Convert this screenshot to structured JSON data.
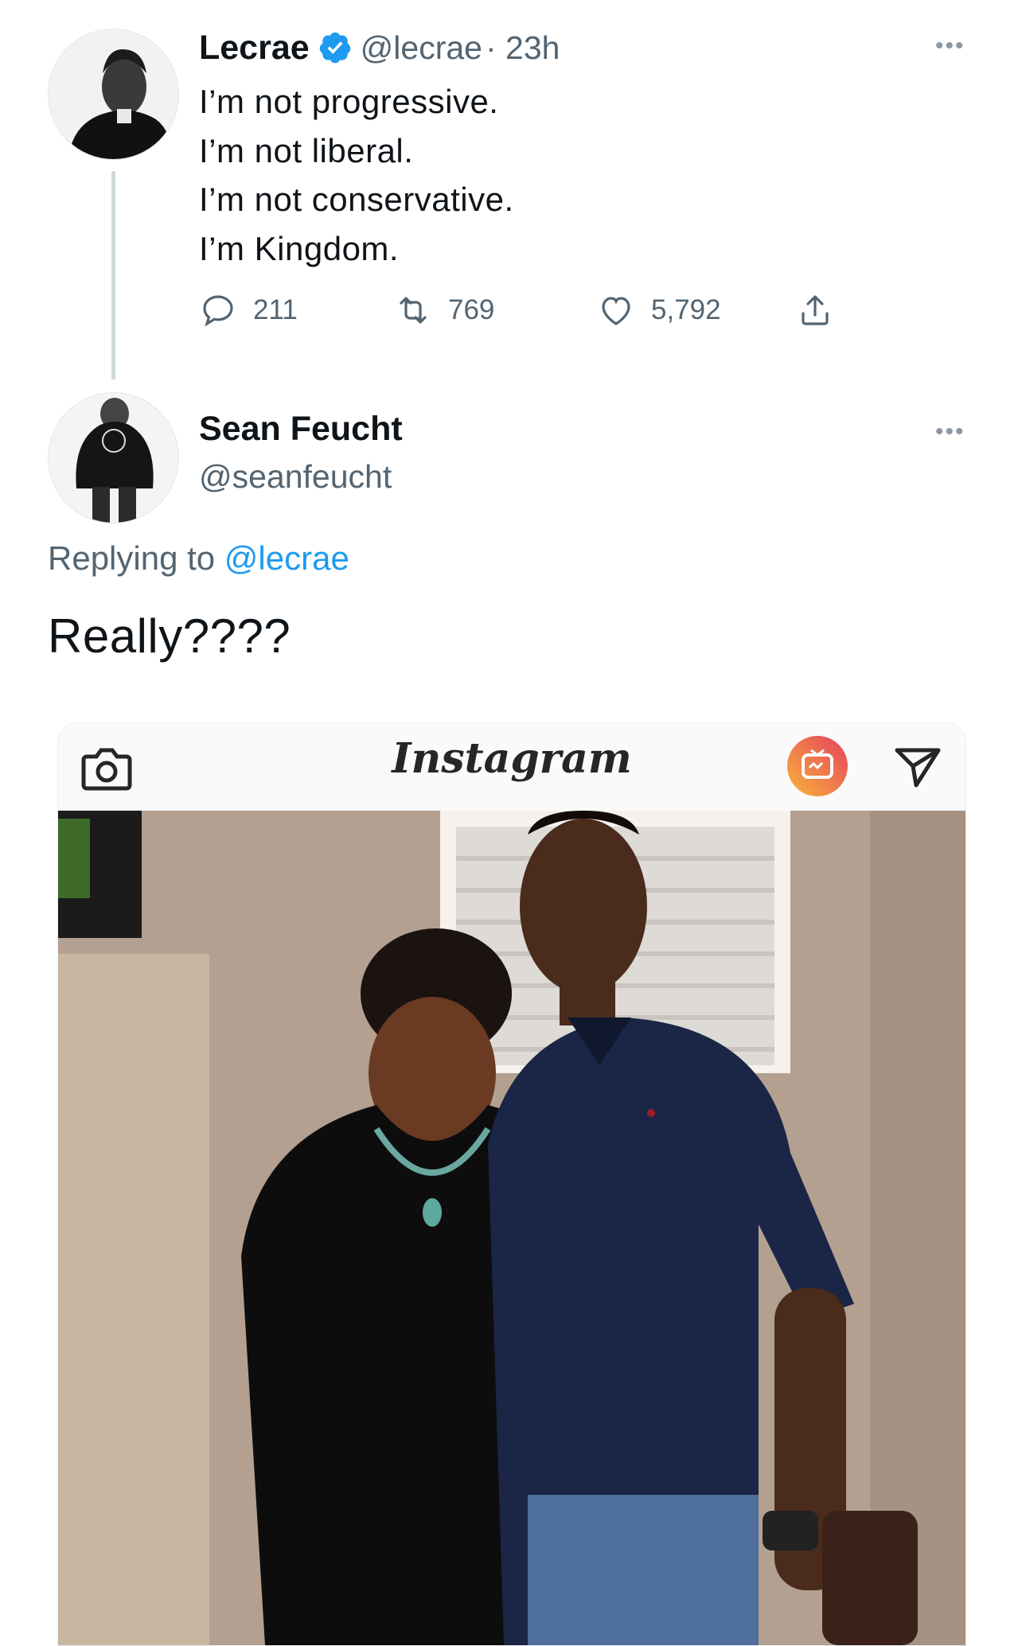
{
  "tweet": {
    "author_name": "Lecrae",
    "author_handle": "@lecrae",
    "time": "· 23h",
    "lines": [
      "I’m not progressive.",
      "I’m not liberal.",
      "I’m not conservative.",
      "I’m Kingdom."
    ],
    "reply_count": "211",
    "retweet_count": "769",
    "like_count": "5,792"
  },
  "reply": {
    "author_name": "Sean Feucht",
    "author_handle": "@seanfeucht",
    "replying_prefix": "Replying to",
    "replying_to": "@lecrae",
    "text": "Really????"
  },
  "instagram": {
    "logo_text": "Instagram"
  },
  "icons": {
    "more": "more-horizontal-icon",
    "verified": "verified-badge-icon",
    "reply": "reply-icon",
    "retweet": "retweet-icon",
    "like": "heart-icon",
    "share": "share-icon",
    "camera": "camera-icon",
    "igtv": "igtv-icon",
    "direct": "direct-message-icon"
  },
  "colors": {
    "accent": "#1d9bf0",
    "muted": "#536471",
    "thread_line": "#cfd9de"
  }
}
